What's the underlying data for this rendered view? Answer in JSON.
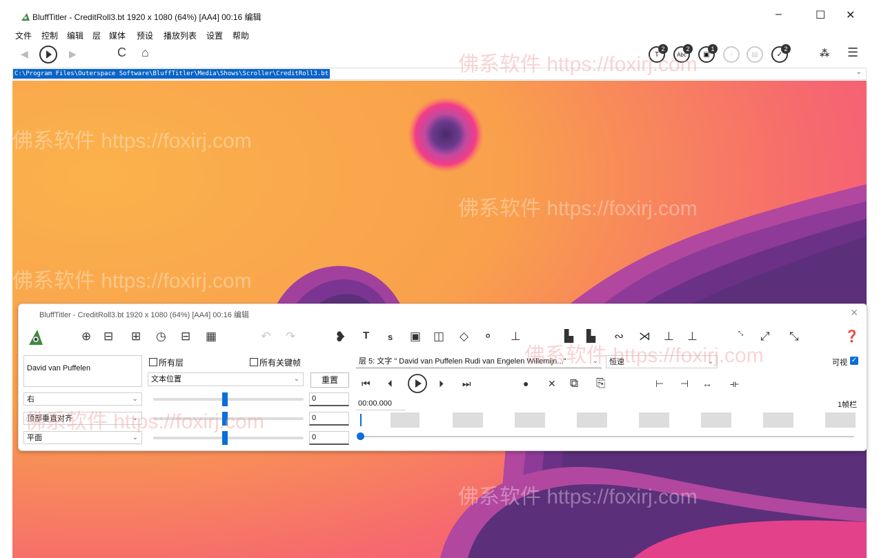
{
  "window": {
    "title": "BluffTitler - CreditRoll3.bt 1920 x 1080 (64%) [AA4] 00:16 编辑",
    "min": "–",
    "max": "☐",
    "close": "✕"
  },
  "menu": [
    "文件",
    "控制",
    "编辑",
    "层",
    "媒体",
    "预设",
    "播放列表",
    "设置",
    "帮助"
  ],
  "toolbar": {
    "back": "◀",
    "play": "▶",
    "forward": "▶",
    "refresh": "C",
    "home": "⌂",
    "badges": [
      "2",
      "2",
      "1",
      "",
      "",
      "2"
    ],
    "layers": "⁂",
    "menu": "☰"
  },
  "path": {
    "value": "C:\\Program Files\\Outerspace Software\\BluffTitler\\Media\\Shows\\Scroller\\CreditRoll3.bt"
  },
  "watermark": "佛系软件 https://foxirj.com",
  "panel": {
    "title": "BluffTitler - CreditRoll3.bt 1920 x 1080 (64%) [AA4] 00:16 编辑",
    "text_value": "David van Puffelen",
    "all_layers": "所有层",
    "all_keyframes": "所有关键帧",
    "property_select": "文本位置",
    "reset": "重置",
    "align_h": "右",
    "align_v": "顶部垂直对齐",
    "plane": "平面",
    "values": [
      "0",
      "0",
      "0"
    ],
    "layer_select": "层  5: 文字 \" David van Puffelen  Rudi van Engelen  Willemijn...\"",
    "speed_select": "恒速",
    "visible": "可视",
    "time": "00:00.000",
    "frames": "1帧栏"
  },
  "colors": {
    "accent": "#0a6fd8",
    "canvas_orange": "#f8a64a",
    "canvas_pink": "#f64a8a",
    "canvas_purple": "#5c2f7a"
  }
}
